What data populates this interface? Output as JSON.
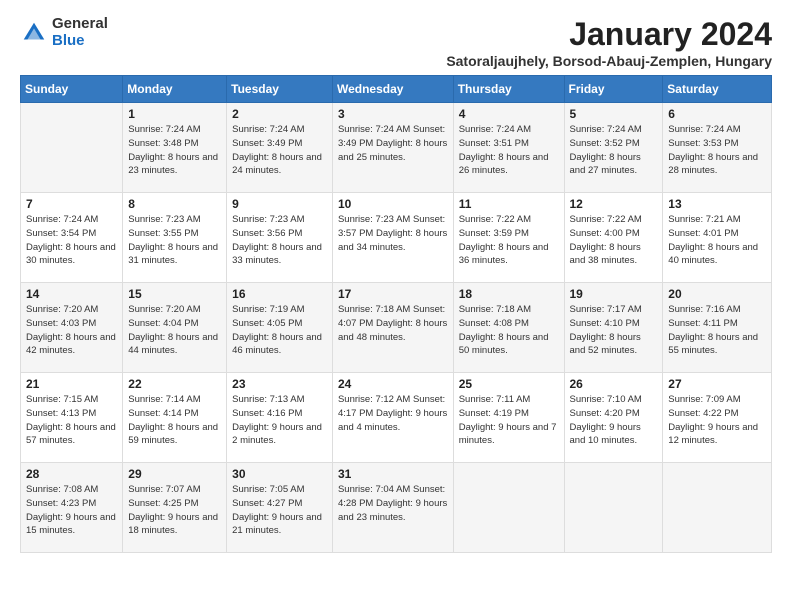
{
  "logo": {
    "general": "General",
    "blue": "Blue"
  },
  "title": "January 2024",
  "subtitle": "Satoraljaujhely, Borsod-Abauj-Zemplen, Hungary",
  "days_header": [
    "Sunday",
    "Monday",
    "Tuesday",
    "Wednesday",
    "Thursday",
    "Friday",
    "Saturday"
  ],
  "weeks": [
    [
      {
        "day": "",
        "detail": ""
      },
      {
        "day": "1",
        "detail": "Sunrise: 7:24 AM\nSunset: 3:48 PM\nDaylight: 8 hours\nand 23 minutes."
      },
      {
        "day": "2",
        "detail": "Sunrise: 7:24 AM\nSunset: 3:49 PM\nDaylight: 8 hours\nand 24 minutes."
      },
      {
        "day": "3",
        "detail": "Sunrise: 7:24 AM\nSunset: 3:49 PM\nDaylight: 8 hours\nand 25 minutes."
      },
      {
        "day": "4",
        "detail": "Sunrise: 7:24 AM\nSunset: 3:51 PM\nDaylight: 8 hours\nand 26 minutes."
      },
      {
        "day": "5",
        "detail": "Sunrise: 7:24 AM\nSunset: 3:52 PM\nDaylight: 8 hours\nand 27 minutes."
      },
      {
        "day": "6",
        "detail": "Sunrise: 7:24 AM\nSunset: 3:53 PM\nDaylight: 8 hours\nand 28 minutes."
      }
    ],
    [
      {
        "day": "7",
        "detail": "Sunrise: 7:24 AM\nSunset: 3:54 PM\nDaylight: 8 hours\nand 30 minutes."
      },
      {
        "day": "8",
        "detail": "Sunrise: 7:23 AM\nSunset: 3:55 PM\nDaylight: 8 hours\nand 31 minutes."
      },
      {
        "day": "9",
        "detail": "Sunrise: 7:23 AM\nSunset: 3:56 PM\nDaylight: 8 hours\nand 33 minutes."
      },
      {
        "day": "10",
        "detail": "Sunrise: 7:23 AM\nSunset: 3:57 PM\nDaylight: 8 hours\nand 34 minutes."
      },
      {
        "day": "11",
        "detail": "Sunrise: 7:22 AM\nSunset: 3:59 PM\nDaylight: 8 hours\nand 36 minutes."
      },
      {
        "day": "12",
        "detail": "Sunrise: 7:22 AM\nSunset: 4:00 PM\nDaylight: 8 hours\nand 38 minutes."
      },
      {
        "day": "13",
        "detail": "Sunrise: 7:21 AM\nSunset: 4:01 PM\nDaylight: 8 hours\nand 40 minutes."
      }
    ],
    [
      {
        "day": "14",
        "detail": "Sunrise: 7:20 AM\nSunset: 4:03 PM\nDaylight: 8 hours\nand 42 minutes."
      },
      {
        "day": "15",
        "detail": "Sunrise: 7:20 AM\nSunset: 4:04 PM\nDaylight: 8 hours\nand 44 minutes."
      },
      {
        "day": "16",
        "detail": "Sunrise: 7:19 AM\nSunset: 4:05 PM\nDaylight: 8 hours\nand 46 minutes."
      },
      {
        "day": "17",
        "detail": "Sunrise: 7:18 AM\nSunset: 4:07 PM\nDaylight: 8 hours\nand 48 minutes."
      },
      {
        "day": "18",
        "detail": "Sunrise: 7:18 AM\nSunset: 4:08 PM\nDaylight: 8 hours\nand 50 minutes."
      },
      {
        "day": "19",
        "detail": "Sunrise: 7:17 AM\nSunset: 4:10 PM\nDaylight: 8 hours\nand 52 minutes."
      },
      {
        "day": "20",
        "detail": "Sunrise: 7:16 AM\nSunset: 4:11 PM\nDaylight: 8 hours\nand 55 minutes."
      }
    ],
    [
      {
        "day": "21",
        "detail": "Sunrise: 7:15 AM\nSunset: 4:13 PM\nDaylight: 8 hours\nand 57 minutes."
      },
      {
        "day": "22",
        "detail": "Sunrise: 7:14 AM\nSunset: 4:14 PM\nDaylight: 8 hours\nand 59 minutes."
      },
      {
        "day": "23",
        "detail": "Sunrise: 7:13 AM\nSunset: 4:16 PM\nDaylight: 9 hours\nand 2 minutes."
      },
      {
        "day": "24",
        "detail": "Sunrise: 7:12 AM\nSunset: 4:17 PM\nDaylight: 9 hours\nand 4 minutes."
      },
      {
        "day": "25",
        "detail": "Sunrise: 7:11 AM\nSunset: 4:19 PM\nDaylight: 9 hours\nand 7 minutes."
      },
      {
        "day": "26",
        "detail": "Sunrise: 7:10 AM\nSunset: 4:20 PM\nDaylight: 9 hours\nand 10 minutes."
      },
      {
        "day": "27",
        "detail": "Sunrise: 7:09 AM\nSunset: 4:22 PM\nDaylight: 9 hours\nand 12 minutes."
      }
    ],
    [
      {
        "day": "28",
        "detail": "Sunrise: 7:08 AM\nSunset: 4:23 PM\nDaylight: 9 hours\nand 15 minutes."
      },
      {
        "day": "29",
        "detail": "Sunrise: 7:07 AM\nSunset: 4:25 PM\nDaylight: 9 hours\nand 18 minutes."
      },
      {
        "day": "30",
        "detail": "Sunrise: 7:05 AM\nSunset: 4:27 PM\nDaylight: 9 hours\nand 21 minutes."
      },
      {
        "day": "31",
        "detail": "Sunrise: 7:04 AM\nSunset: 4:28 PM\nDaylight: 9 hours\nand 23 minutes."
      },
      {
        "day": "",
        "detail": ""
      },
      {
        "day": "",
        "detail": ""
      },
      {
        "day": "",
        "detail": ""
      }
    ]
  ]
}
